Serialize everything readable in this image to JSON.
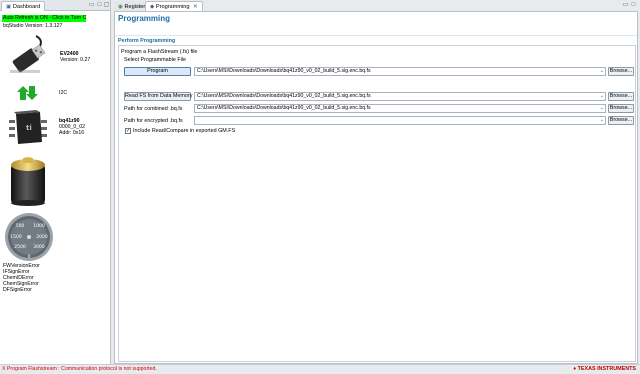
{
  "left_panel": {
    "tab_label": "Dashboard",
    "auto_refresh": "Auto Refresh is ON - Click to Turn OFF",
    "version": "bqStudio Version:  1.3.127",
    "device": {
      "name": "EV2400",
      "version": "Version: 0.27"
    },
    "bus": "I2C",
    "chip": {
      "name": "bq41z90",
      "rev": "0000_0_02",
      "addr": "Addr: 0x16"
    },
    "gauge": {
      "ticks": [
        "500",
        "1000",
        "1500",
        "2000",
        "2500",
        "3000",
        "0"
      ]
    },
    "errors": [
      "FWVersionError",
      "IFSignError",
      "ChemIDError",
      "ChemSignError",
      "DFSignError"
    ]
  },
  "editor_tabs": [
    {
      "label": "Registers",
      "icon": "registers-icon"
    },
    {
      "label": "Programming",
      "icon": "programming-icon"
    }
  ],
  "editor": {
    "title": "Programming",
    "section": "Perform Programming",
    "fieldset_label": "Program a FlashStream (.fs) file",
    "select_label": "Select Programmable File",
    "program_button": "Program",
    "program_file": "C:\\Users\\MSI\\Downloads\\Downloads\\bq41z90_v0_02_build_5.sig.enc.bq.fs",
    "browse_label": "Browse...",
    "read_button": "Read FS from Data Memory",
    "read_file": "C:\\Users\\MSI\\Downloads\\Downloads\\bq41z90_v0_02_build_5.sig.enc.bq.fs",
    "combined_label": "Path for combined .bq.fs",
    "combined_path": "C:\\Users\\MSI\\Downloads\\Downloads\\bq41z90_v0_02_build_5.sig.enc.bq.fs",
    "encrypted_label": "Path for encrypted .bq.fs",
    "encrypted_path": "",
    "checkbox_label": "Include Read/Compare in exported GM.FS",
    "checkbox_checked": true
  },
  "status": {
    "message": "X Program Flashstream : Communication protocol is not supported.",
    "logo": "TEXAS INSTRUMENTS"
  }
}
